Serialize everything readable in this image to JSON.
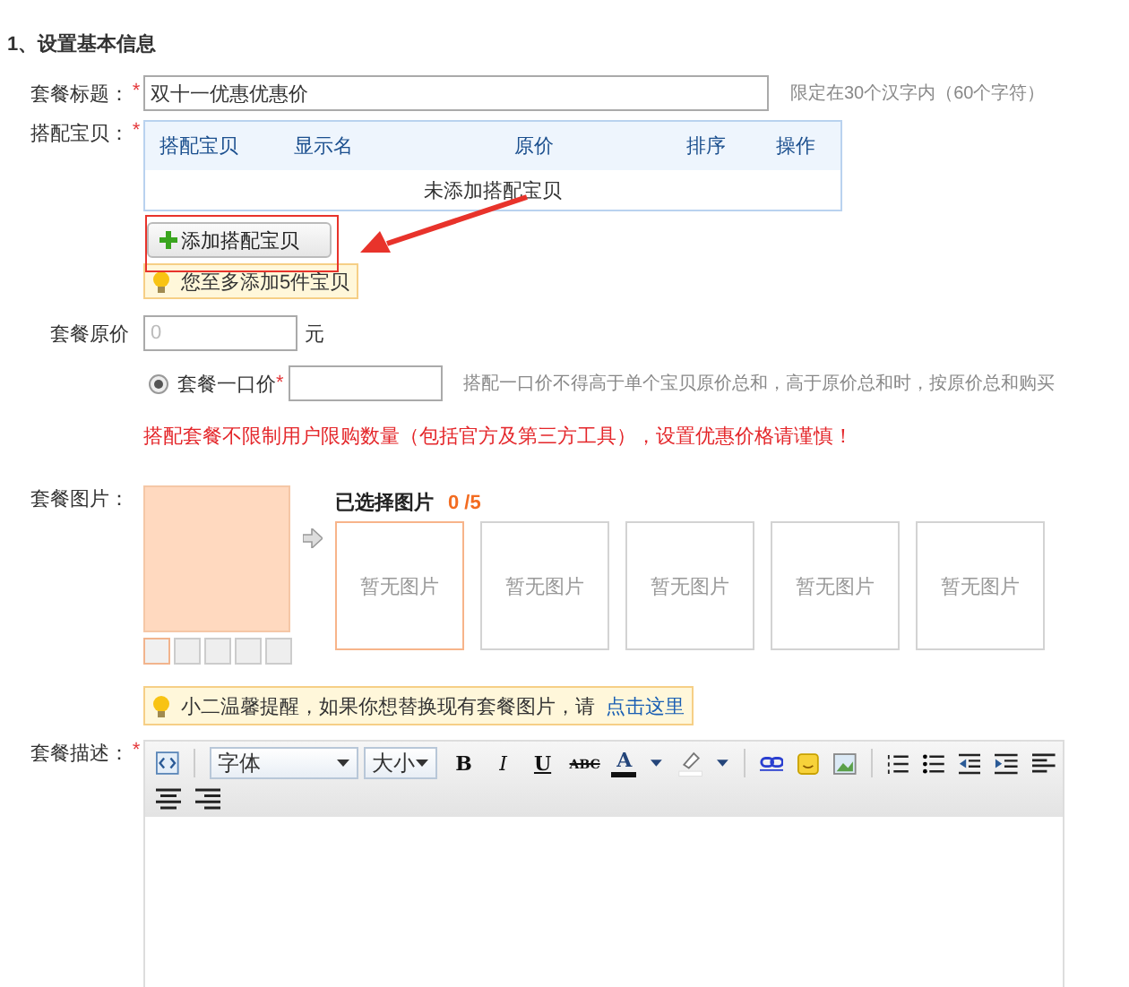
{
  "section_title": "1、设置基本信息",
  "title_field": {
    "label": "套餐标题：",
    "required_mark": "*",
    "value": "双十一优惠优惠价",
    "hint": "限定在30个汉字内（60个字符）"
  },
  "items": {
    "label": "搭配宝贝：",
    "required_mark": "*",
    "columns": [
      "搭配宝贝",
      "显示名",
      "原价",
      "排序",
      "操作"
    ],
    "empty_text": "未添加搭配宝贝",
    "add_button": "添加搭配宝贝",
    "tip": "您至多添加5件宝贝"
  },
  "original_price": {
    "label": "套餐原价",
    "placeholder": "0",
    "unit": "元"
  },
  "fixed_price": {
    "label": "套餐一口价",
    "selected": true,
    "required_mark": "*",
    "note": "搭配一口价不得高于单个宝贝原价总和，高于原价总和时，按原价总和购买"
  },
  "warning": "搭配套餐不限制用户限购数量（包括官方及第三方工具），设置优惠价格请谨慎！",
  "images": {
    "label": "套餐图片：",
    "thumbnails": [
      {
        "selected": true
      },
      {
        "selected": false
      },
      {
        "selected": false
      },
      {
        "selected": false
      },
      {
        "selected": false
      }
    ],
    "selected_label": "已选择图片",
    "count": "0 /5",
    "slots": [
      {
        "text": "暂无图片",
        "selected": true
      },
      {
        "text": "暂无图片",
        "selected": false
      },
      {
        "text": "暂无图片",
        "selected": false
      },
      {
        "text": "暂无图片",
        "selected": false
      },
      {
        "text": "暂无图片",
        "selected": false
      }
    ],
    "tip": "小二温馨提醒，如果你想替换现有套餐图片，请",
    "tip_link": "点击这里"
  },
  "description": {
    "label": "套餐描述：",
    "required_mark": "*",
    "font_select": "字体",
    "size_select": "大小",
    "bold": "B",
    "italic": "I",
    "underline": "U",
    "strike": "ABC",
    "text_color_button": "A"
  }
}
